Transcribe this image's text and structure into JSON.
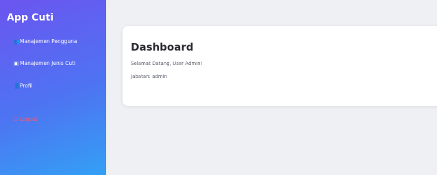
{
  "sidebar": {
    "brand": "App Cuti",
    "items": [
      {
        "icon": "users-icon",
        "glyph": "👥",
        "label": "Manajemen Pengguna"
      },
      {
        "icon": "calendar-icon",
        "glyph": "▣",
        "label": "Manajemen Jenis Cuti"
      },
      {
        "icon": "user-icon",
        "glyph": "👤",
        "label": "Profil"
      },
      {
        "icon": "logout-icon",
        "glyph": "⎋",
        "label": "Logout"
      }
    ]
  },
  "card": {
    "title": "Dashboard",
    "welcome": "Selamat Datang, User Admin!",
    "role": "Jabatan: admin"
  },
  "colors": {
    "sidebar_start": "#6b55f0",
    "sidebar_end": "#33a0f4",
    "logout": "#ff5b6b",
    "background": "#eef0f3"
  }
}
